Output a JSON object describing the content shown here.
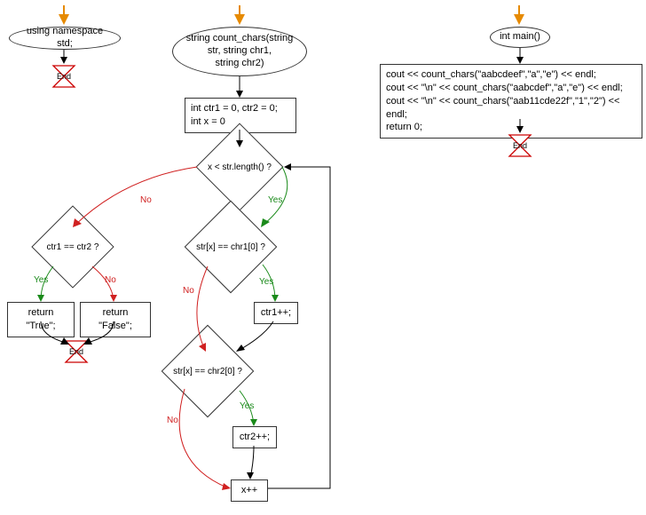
{
  "chart_data": {
    "type": "flowchart",
    "flowcharts": [
      {
        "name": "namespace",
        "nodes": [
          {
            "id": "ns_start",
            "kind": "start"
          },
          {
            "id": "ns_decl",
            "kind": "terminator",
            "text": "using namespace std;"
          },
          {
            "id": "ns_end",
            "kind": "end",
            "text": "End"
          }
        ],
        "edges": [
          {
            "from": "ns_start",
            "to": "ns_decl"
          },
          {
            "from": "ns_decl",
            "to": "ns_end"
          }
        ]
      },
      {
        "name": "count_chars",
        "nodes": [
          {
            "id": "cc_start",
            "kind": "start"
          },
          {
            "id": "cc_sig",
            "kind": "terminator",
            "text": "string count_chars(string str, string chr1, string chr2)"
          },
          {
            "id": "cc_init",
            "kind": "process",
            "text": "int ctr1 = 0, ctr2 = 0;\nint x = 0"
          },
          {
            "id": "cc_loop",
            "kind": "decision",
            "text": "x < str.length() ?"
          },
          {
            "id": "cc_eq",
            "kind": "decision",
            "text": "ctr1 == ctr2 ?"
          },
          {
            "id": "cc_true",
            "kind": "process",
            "text": "return \"True\";"
          },
          {
            "id": "cc_false",
            "kind": "process",
            "text": "return \"False\";"
          },
          {
            "id": "cc_end1",
            "kind": "end",
            "text": "End"
          },
          {
            "id": "cc_d1",
            "kind": "decision",
            "text": "str[x] == chr1[0] ?"
          },
          {
            "id": "cc_inc1",
            "kind": "process",
            "text": "ctr1++;"
          },
          {
            "id": "cc_d2",
            "kind": "decision",
            "text": "str[x] == chr2[0] ?"
          },
          {
            "id": "cc_inc2",
            "kind": "process",
            "text": "ctr2++;"
          },
          {
            "id": "cc_xpp",
            "kind": "process",
            "text": "x++"
          }
        ],
        "edges": [
          {
            "from": "cc_start",
            "to": "cc_sig"
          },
          {
            "from": "cc_sig",
            "to": "cc_init"
          },
          {
            "from": "cc_init",
            "to": "cc_loop"
          },
          {
            "from": "cc_loop",
            "to": "cc_eq",
            "label": "No"
          },
          {
            "from": "cc_loop",
            "to": "cc_d1",
            "label": "Yes"
          },
          {
            "from": "cc_eq",
            "to": "cc_true",
            "label": "Yes"
          },
          {
            "from": "cc_eq",
            "to": "cc_false",
            "label": "No"
          },
          {
            "from": "cc_true",
            "to": "cc_end1"
          },
          {
            "from": "cc_false",
            "to": "cc_end1"
          },
          {
            "from": "cc_d1",
            "to": "cc_inc1",
            "label": "Yes"
          },
          {
            "from": "cc_d1",
            "to": "cc_d2",
            "label": "No"
          },
          {
            "from": "cc_inc1",
            "to": "cc_d2"
          },
          {
            "from": "cc_d2",
            "to": "cc_inc2",
            "label": "Yes"
          },
          {
            "from": "cc_d2",
            "to": "cc_xpp",
            "label": "No"
          },
          {
            "from": "cc_inc2",
            "to": "cc_xpp"
          },
          {
            "from": "cc_xpp",
            "to": "cc_loop"
          }
        ]
      },
      {
        "name": "main",
        "nodes": [
          {
            "id": "m_start",
            "kind": "start"
          },
          {
            "id": "m_sig",
            "kind": "terminator",
            "text": "int main()"
          },
          {
            "id": "m_body",
            "kind": "process",
            "text": "cout << count_chars(\"aabcdeef\",\"a\",\"e\") << endl;\ncout << \"\\n\" << count_chars(\"aabcdef\",\"a\",\"e\") << endl;\ncout << \"\\n\" << count_chars(\"aab11cde22f\",\"1\",\"2\") << endl;\nreturn 0;"
          },
          {
            "id": "m_end",
            "kind": "end",
            "text": "End"
          }
        ],
        "edges": [
          {
            "from": "m_start",
            "to": "m_sig"
          },
          {
            "from": "m_sig",
            "to": "m_body"
          },
          {
            "from": "m_body",
            "to": "m_end"
          }
        ]
      }
    ]
  },
  "labels": {
    "yes": "Yes",
    "no": "No",
    "end": "End",
    "ns_decl": "using namespace std;",
    "cc_sig_l1": "string count_chars(string",
    "cc_sig_l2": "str, string chr1,",
    "cc_sig_l3": "string chr2)",
    "cc_init_l1": "int ctr1 = 0, ctr2 = 0;",
    "cc_init_l2": "int x = 0",
    "cc_loop": "x < str.length() ?",
    "cc_eq": "ctr1 == ctr2 ?",
    "cc_true": "return \"True\";",
    "cc_false": "return \"False\";",
    "cc_d1": "str[x] == chr1[0] ?",
    "cc_inc1": "ctr1++;",
    "cc_d2": "str[x] == chr2[0] ?",
    "cc_inc2": "ctr2++;",
    "cc_xpp": "x++",
    "m_sig": "int main()",
    "m_body_l1": "cout << count_chars(\"aabcdeef\",\"a\",\"e\") << endl;",
    "m_body_l2": "cout << \"\\n\" << count_chars(\"aabcdef\",\"a\",\"e\") << endl;",
    "m_body_l3": "cout << \"\\n\" << count_chars(\"aab11cde22f\",\"1\",\"2\") << endl;",
    "m_body_l4": "return 0;"
  }
}
